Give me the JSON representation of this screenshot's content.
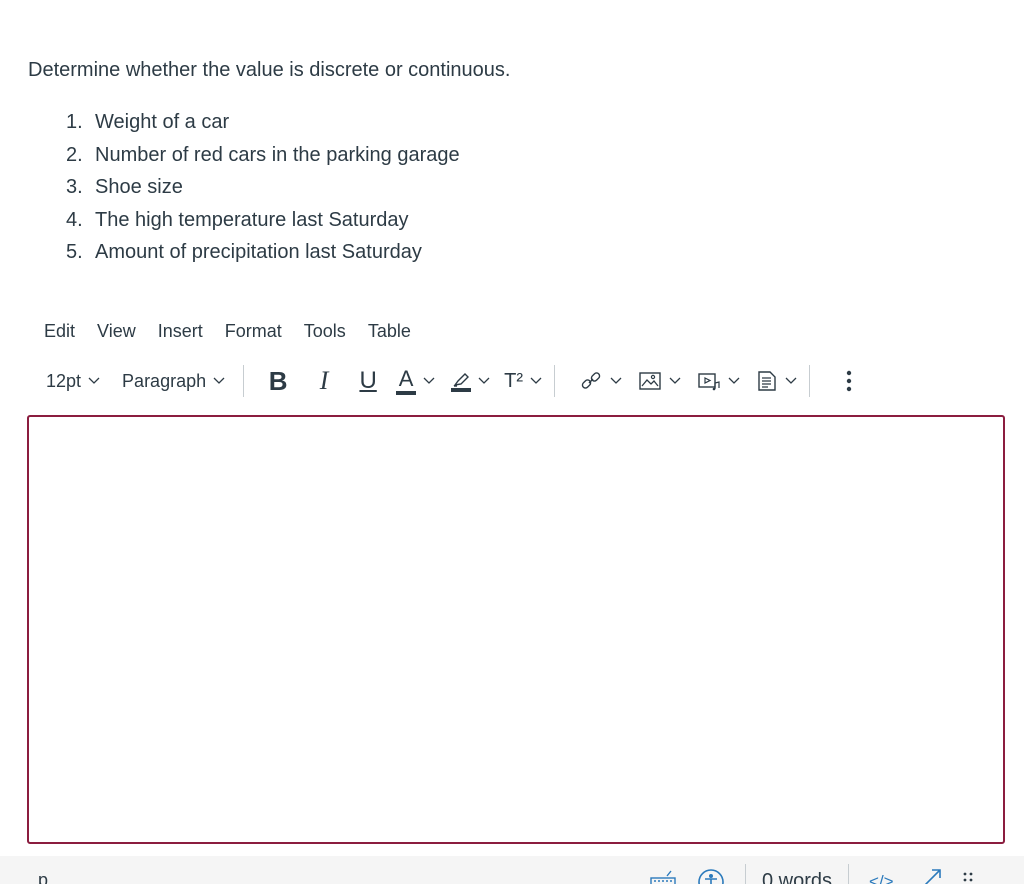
{
  "question": {
    "prompt": "Determine whether the value is discrete or continuous.",
    "items": [
      {
        "num": "1.",
        "text": "Weight of a car"
      },
      {
        "num": "2.",
        "text": "Number of red cars in the parking garage"
      },
      {
        "num": "3.",
        "text": "Shoe size"
      },
      {
        "num": "4.",
        "text": "The high temperature last Saturday"
      },
      {
        "num": "5.",
        "text": "Amount of precipitation last Saturday"
      }
    ]
  },
  "menubar": {
    "edit": "Edit",
    "view": "View",
    "insert": "Insert",
    "format": "Format",
    "tools": "Tools",
    "table": "Table"
  },
  "toolbar": {
    "font_size": "12pt",
    "block_format": "Paragraph",
    "bold_label": "B",
    "italic_label": "I",
    "underline_label": "U",
    "text_color_label": "A",
    "superscript_label": "T²",
    "icons": [
      "bold-icon",
      "italic-icon",
      "underline-icon",
      "text-color-icon",
      "highlight-icon",
      "superscript-icon",
      "link-icon",
      "image-icon",
      "media-icon",
      "document-icon",
      "more-icon"
    ]
  },
  "statusbar": {
    "path": "p",
    "word_count": "0 words",
    "html_toggle": "</>",
    "icons": [
      "keyboard-icon",
      "accessibility-icon",
      "fullscreen-icon",
      "resize-handle-icon"
    ]
  },
  "colors": {
    "text": "#2d3b45",
    "editor_border": "#8b1d3f",
    "link_blue": "#2b7abc",
    "separator": "#c7cdd1"
  }
}
